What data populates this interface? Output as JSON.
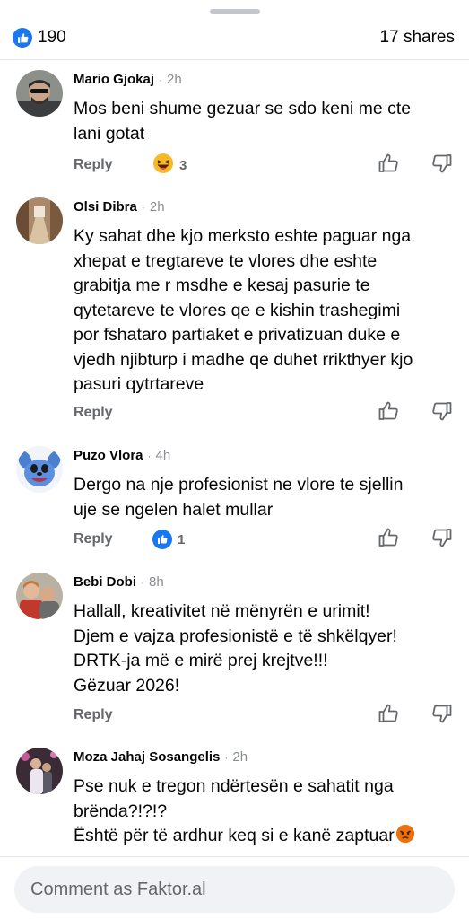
{
  "summary": {
    "like_count": "190",
    "shares": "17 shares"
  },
  "comments": [
    {
      "author": "Mario Gjokaj",
      "time": "2h",
      "lines": [
        "Mos beni shume gezuar se sdo keni me cte",
        "lani gotat"
      ],
      "reply_label": "Reply",
      "reaction_count": "3",
      "reaction_icon": "laughing-emoji-icon"
    },
    {
      "author": "Olsi Dibra",
      "time": "2h",
      "lines": [
        "Ky sahat dhe kjo merksto eshte paguar nga",
        "xhepat e tregtareve te vlores dhe eshte",
        "grabitja me r msdhe e kesaj pasurie te",
        "qytetareve te vlores qe e kishin trashegimi",
        "por fshataro partiaket e privatizuan duke e",
        "vjedh njibturp i madhe qe duhet rrikthyer kjo",
        "pasuri qytrtareve"
      ],
      "reply_label": "Reply"
    },
    {
      "author": "Puzo Vlora",
      "time": "4h",
      "lines": [
        "Dergo na nje profesionist ne vlore te sjellin",
        "uje se ngelen halet mullar"
      ],
      "reply_label": "Reply",
      "reaction_count": "1",
      "reaction_icon": "like-icon"
    },
    {
      "author": "Bebi Dobi",
      "time": "8h",
      "lines": [
        "Hallall, kreativitet në mënyrën e urimit!",
        "Djem e vajza profesionistë e të shkëlqyer!",
        "DRTK-ja më e mirë prej krejtve!!!",
        "Gëzuar 2026!"
      ],
      "reply_label": "Reply"
    },
    {
      "author": "Moza Jahaj Sosangelis",
      "time": "2h",
      "lines": [
        "Pse nuk e tregon ndërtesën e sahatit nga",
        "brënda?!?!?",
        "Është për të ardhur keq si e kanë zaptuar"
      ]
    }
  ],
  "composer": {
    "placeholder": "Comment as Faktor.al"
  },
  "colors": {
    "brand_blue": "#1877f2",
    "meta_gray": "#65676b",
    "input_bg": "#f0f2f5"
  }
}
